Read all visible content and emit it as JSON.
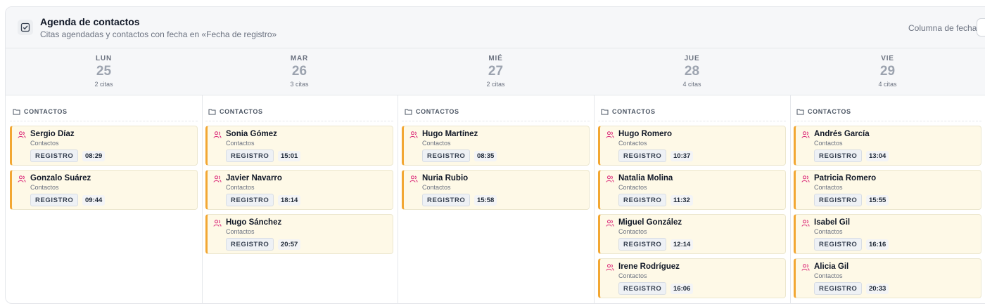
{
  "header": {
    "title": "Agenda de contactos",
    "subtitle": "Citas agendadas y contactos con fecha en «Fecha de registro»",
    "column_label": "Columna de fecha"
  },
  "colors": {
    "card_bg": "#fef9e7",
    "card_accent": "#f2a733",
    "contact_icon": "#db2777"
  },
  "days": [
    {
      "name": "LUN",
      "num": "25",
      "count": "2 citas",
      "group": "CONTACTOS",
      "cards": [
        {
          "name": "Sergio Díaz",
          "sub": "Contactos",
          "badge": "REGISTRO",
          "time": "08:29"
        },
        {
          "name": "Gonzalo Suárez",
          "sub": "Contactos",
          "badge": "REGISTRO",
          "time": "09:44"
        }
      ]
    },
    {
      "name": "MAR",
      "num": "26",
      "count": "3 citas",
      "group": "CONTACTOS",
      "cards": [
        {
          "name": "Sonia Gómez",
          "sub": "Contactos",
          "badge": "REGISTRO",
          "time": "15:01"
        },
        {
          "name": "Javier Navarro",
          "sub": "Contactos",
          "badge": "REGISTRO",
          "time": "18:14"
        },
        {
          "name": "Hugo Sánchez",
          "sub": "Contactos",
          "badge": "REGISTRO",
          "time": "20:57"
        }
      ]
    },
    {
      "name": "MIÉ",
      "num": "27",
      "count": "2 citas",
      "group": "CONTACTOS",
      "cards": [
        {
          "name": "Hugo Martínez",
          "sub": "Contactos",
          "badge": "REGISTRO",
          "time": "08:35"
        },
        {
          "name": "Nuria Rubio",
          "sub": "Contactos",
          "badge": "REGISTRO",
          "time": "15:58"
        }
      ]
    },
    {
      "name": "JUE",
      "num": "28",
      "count": "4 citas",
      "group": "CONTACTOS",
      "cards": [
        {
          "name": "Hugo Romero",
          "sub": "Contactos",
          "badge": "REGISTRO",
          "time": "10:37"
        },
        {
          "name": "Natalia Molina",
          "sub": "Contactos",
          "badge": "REGISTRO",
          "time": "11:32"
        },
        {
          "name": "Miguel González",
          "sub": "Contactos",
          "badge": "REGISTRO",
          "time": "12:14"
        },
        {
          "name": "Irene Rodríguez",
          "sub": "Contactos",
          "badge": "REGISTRO",
          "time": "16:06"
        }
      ]
    },
    {
      "name": "VIE",
      "num": "29",
      "count": "4 citas",
      "group": "CONTACTOS",
      "cards": [
        {
          "name": "Andrés García",
          "sub": "Contactos",
          "badge": "REGISTRO",
          "time": "13:04"
        },
        {
          "name": "Patricia Romero",
          "sub": "Contactos",
          "badge": "REGISTRO",
          "time": "15:55"
        },
        {
          "name": "Isabel Gil",
          "sub": "Contactos",
          "badge": "REGISTRO",
          "time": "16:16"
        },
        {
          "name": "Alicia Gil",
          "sub": "Contactos",
          "badge": "REGISTRO",
          "time": "20:33"
        }
      ]
    }
  ]
}
